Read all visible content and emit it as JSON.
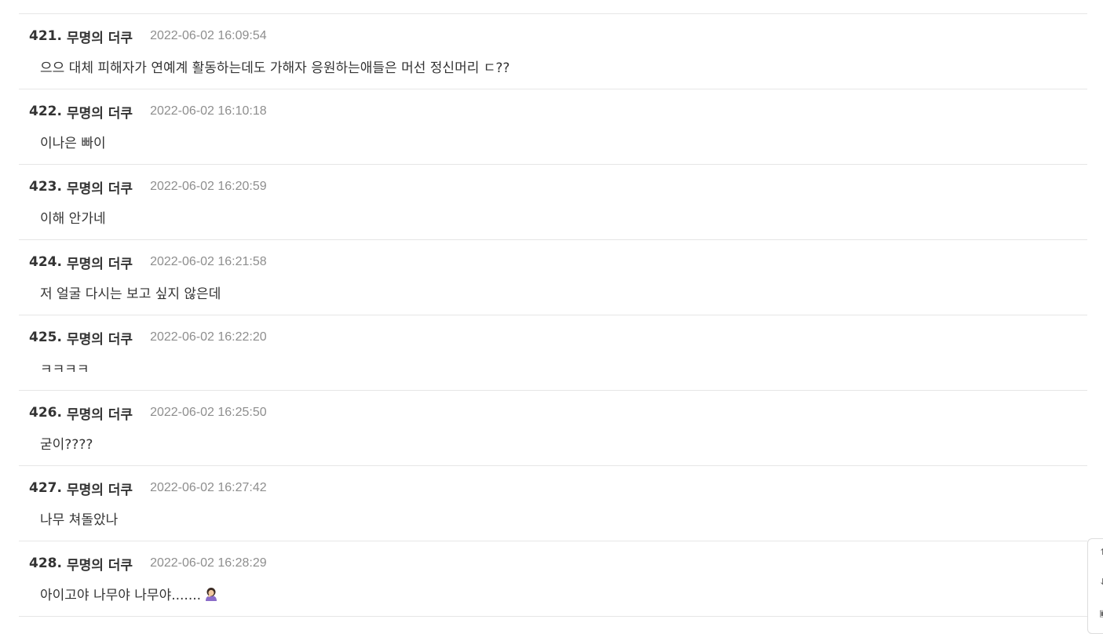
{
  "comments": [
    {
      "num": "421.",
      "author": "무명의 더쿠",
      "time": "2022-06-02 16:09:54",
      "body": "으으 대체 피해자가 연예계 활동하는데도 가해자 응원하는애들은 머선 정신머리 ㄷ??"
    },
    {
      "num": "422.",
      "author": "무명의 더쿠",
      "time": "2022-06-02 16:10:18",
      "body": "이나은 빠이"
    },
    {
      "num": "423.",
      "author": "무명의 더쿠",
      "time": "2022-06-02 16:20:59",
      "body": "이해 안가네"
    },
    {
      "num": "424.",
      "author": "무명의 더쿠",
      "time": "2022-06-02 16:21:58",
      "body": "저 얼굴 다시는 보고 싶지 않은데"
    },
    {
      "num": "425.",
      "author": "무명의 더쿠",
      "time": "2022-06-02 16:22:20",
      "body": "ㅋㅋㅋㅋ"
    },
    {
      "num": "426.",
      "author": "무명의 더쿠",
      "time": "2022-06-02 16:25:50",
      "body": "굳이????"
    },
    {
      "num": "427.",
      "author": "무명의 더쿠",
      "time": "2022-06-02 16:27:42",
      "body": "나무 쳐돌았나"
    },
    {
      "num": "428.",
      "author": "무명의 더쿠",
      "time": "2022-06-02 16:28:29",
      "body": "아이고야 나무야 나무야.......",
      "emoji": "woman-facepalming-icon"
    }
  ],
  "side_tool": {
    "up_icon": "arrow-up-icon",
    "down_icon": "arrow-down-icon",
    "comment_icon": "comment-icon"
  }
}
